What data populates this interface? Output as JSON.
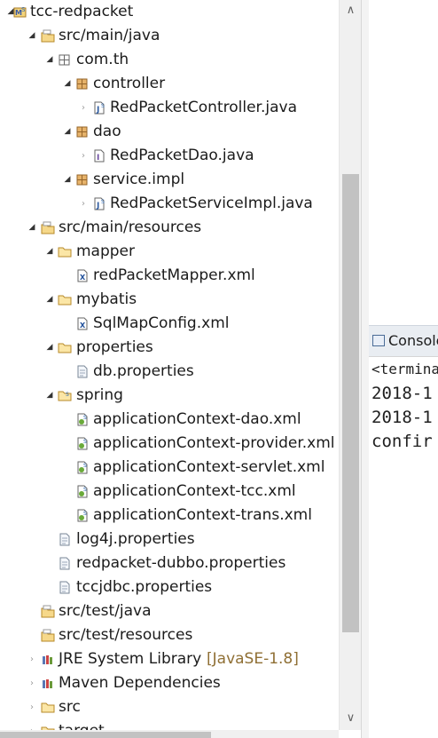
{
  "explorer": {
    "items": [
      {
        "label": "tcc-redpacket",
        "twisty": "expanded",
        "icon": "project-icon"
      },
      {
        "label": "src/main/java",
        "twisty": "expanded",
        "icon": "source-folder-icon"
      },
      {
        "label": "com.th",
        "twisty": "expanded",
        "icon": "package-empty-icon"
      },
      {
        "label": "controller",
        "twisty": "expanded",
        "icon": "package-icon"
      },
      {
        "label": "RedPacketController.java",
        "twisty": "collapsed",
        "icon": "java-file-icon"
      },
      {
        "label": "dao",
        "twisty": "expanded",
        "icon": "package-icon"
      },
      {
        "label": "RedPacketDao.java",
        "twisty": "collapsed",
        "icon": "java-interface-icon"
      },
      {
        "label": "service.impl",
        "twisty": "expanded",
        "icon": "package-icon"
      },
      {
        "label": "RedPacketServiceImpl.java",
        "twisty": "collapsed",
        "icon": "java-file-icon"
      },
      {
        "label": "src/main/resources",
        "twisty": "expanded",
        "icon": "source-folder-icon"
      },
      {
        "label": "mapper",
        "twisty": "expanded",
        "icon": "folder-icon"
      },
      {
        "label": "redPacketMapper.xml",
        "twisty": "none",
        "icon": "xml-file-icon"
      },
      {
        "label": "mybatis",
        "twisty": "expanded",
        "icon": "folder-icon"
      },
      {
        "label": "SqlMapConfig.xml",
        "twisty": "none",
        "icon": "xml-file-icon"
      },
      {
        "label": "properties",
        "twisty": "expanded",
        "icon": "folder-icon"
      },
      {
        "label": "db.properties",
        "twisty": "none",
        "icon": "properties-file-icon"
      },
      {
        "label": "spring",
        "twisty": "expanded",
        "icon": "spring-folder-icon"
      },
      {
        "label": "applicationContext-dao.xml",
        "twisty": "none",
        "icon": "spring-config-icon"
      },
      {
        "label": "applicationContext-provider.xml",
        "twisty": "none",
        "icon": "spring-config-icon"
      },
      {
        "label": "applicationContext-servlet.xml",
        "twisty": "none",
        "icon": "spring-config-icon"
      },
      {
        "label": "applicationContext-tcc.xml",
        "twisty": "none",
        "icon": "spring-config-icon"
      },
      {
        "label": "applicationContext-trans.xml",
        "twisty": "none",
        "icon": "spring-config-icon"
      },
      {
        "label": "log4j.properties",
        "twisty": "none",
        "icon": "properties-file-icon"
      },
      {
        "label": "redpacket-dubbo.properties",
        "twisty": "none",
        "icon": "properties-file-icon"
      },
      {
        "label": "tccjdbc.properties",
        "twisty": "none",
        "icon": "properties-file-icon"
      },
      {
        "label": "src/test/java",
        "twisty": "none",
        "icon": "source-folder-icon"
      },
      {
        "label": "src/test/resources",
        "twisty": "none",
        "icon": "source-folder-icon"
      },
      {
        "label": "JRE System Library",
        "decoration": "[JavaSE-1.8]",
        "twisty": "collapsed",
        "icon": "library-icon"
      },
      {
        "label": "Maven Dependencies",
        "twisty": "collapsed",
        "icon": "library-icon"
      },
      {
        "label": "src",
        "twisty": "collapsed",
        "icon": "folder-icon"
      },
      {
        "label": "target",
        "twisty": "collapsed",
        "icon": "folder-icon"
      }
    ]
  },
  "console": {
    "title": "Console",
    "terminated": "<terminated>",
    "lines": [
      "2018-1",
      "2018-1",
      "confir"
    ]
  },
  "scrollbar": {
    "up_arrow": "∧",
    "down_arrow": "∨"
  }
}
